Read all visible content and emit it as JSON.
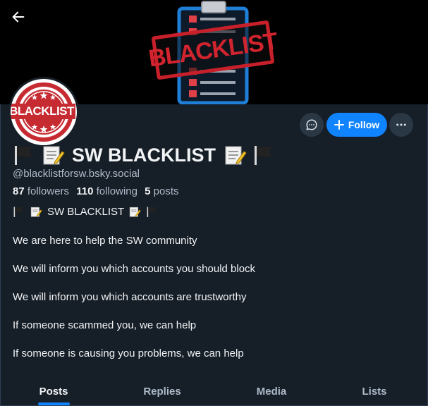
{
  "profile": {
    "banner_text": "BLACKLIST",
    "avatar_text": "BLACKLIST",
    "display_name": "SW BLACKLIST",
    "handle": "@blacklistforsw.bsky.social",
    "stats": {
      "followers_count": "87",
      "followers_label": "followers",
      "following_count": "110",
      "following_label": "following",
      "posts_count": "5",
      "posts_label": "posts"
    },
    "bio_title": "SW BLACKLIST",
    "bio_lines": [
      "We are here to help the SW community",
      "We will inform you which accounts you should block",
      "We will inform you which accounts are trustworthy",
      "If someone scammed you, we can help",
      "If someone is causing you problems, we can help"
    ]
  },
  "actions": {
    "follow_label": "Follow"
  },
  "tabs": [
    {
      "label": "Posts",
      "active": true
    },
    {
      "label": "Replies",
      "active": false
    },
    {
      "label": "Media",
      "active": false
    },
    {
      "label": "Lists",
      "active": false
    }
  ],
  "icons": {
    "back": "arrow-left-icon",
    "message": "chat-bubble-icon",
    "follow": "plus-icon",
    "more": "ellipsis-icon",
    "name_decor": [
      "black-flag-icon",
      "memo-icon"
    ]
  },
  "colors": {
    "background": "#161e27",
    "accent": "#1083fe",
    "text_secondary": "#aebbc9",
    "stamp_red": "#c8202a"
  }
}
